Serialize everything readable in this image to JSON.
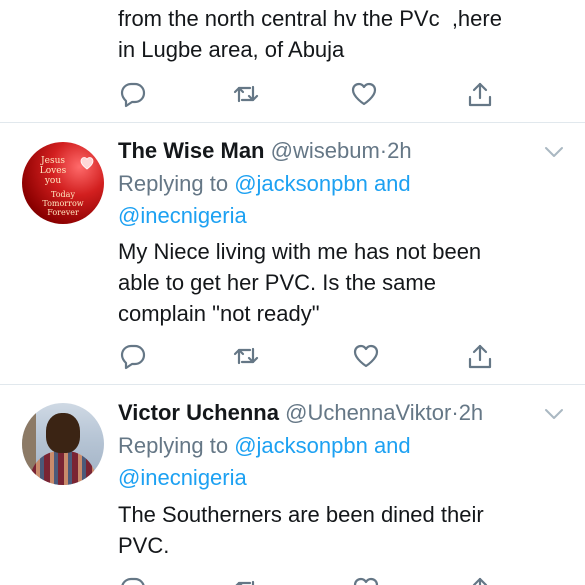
{
  "tweet0": {
    "text_lines": [
      "from the north central hv the PVc  ,here",
      "in Lugbe area, of Abuja"
    ]
  },
  "tweet1": {
    "name": "The Wise Man",
    "handle": "@wisebum",
    "sep": "·",
    "time": "2h",
    "reply_prefix": "Replying to ",
    "reply_mention_1": "@jacksonpbn",
    "reply_and": " and",
    "reply_mention_2": "@inecnigeria",
    "text_lines": [
      "My Niece living with me has not been",
      "able to get her PVC. Is the same",
      "complain \"not ready\""
    ],
    "avatar_text_top": [
      "Jesus",
      "Loves",
      "you"
    ],
    "avatar_text_bottom": [
      "Today",
      "Tomorrow",
      "Forever"
    ]
  },
  "tweet2": {
    "name": "Victor Uchenna",
    "handle": "@UchennaViktor",
    "sep": "·",
    "time": "2h",
    "reply_prefix": "Replying to ",
    "reply_mention_1": "@jacksonpbn",
    "reply_and": " and",
    "reply_mention_2": "@inecnigeria",
    "text_lines": [
      "The Southerners are been dined their",
      "PVC."
    ]
  },
  "icons": {
    "reply": "reply-bubble-icon",
    "retweet": "retweet-icon",
    "like": "heart-icon",
    "share": "share-icon",
    "more": "chevron-down-icon"
  },
  "colors": {
    "text": "#14171a",
    "secondary": "#657786",
    "link": "#1da1f2",
    "divider": "#e1e8ed"
  }
}
